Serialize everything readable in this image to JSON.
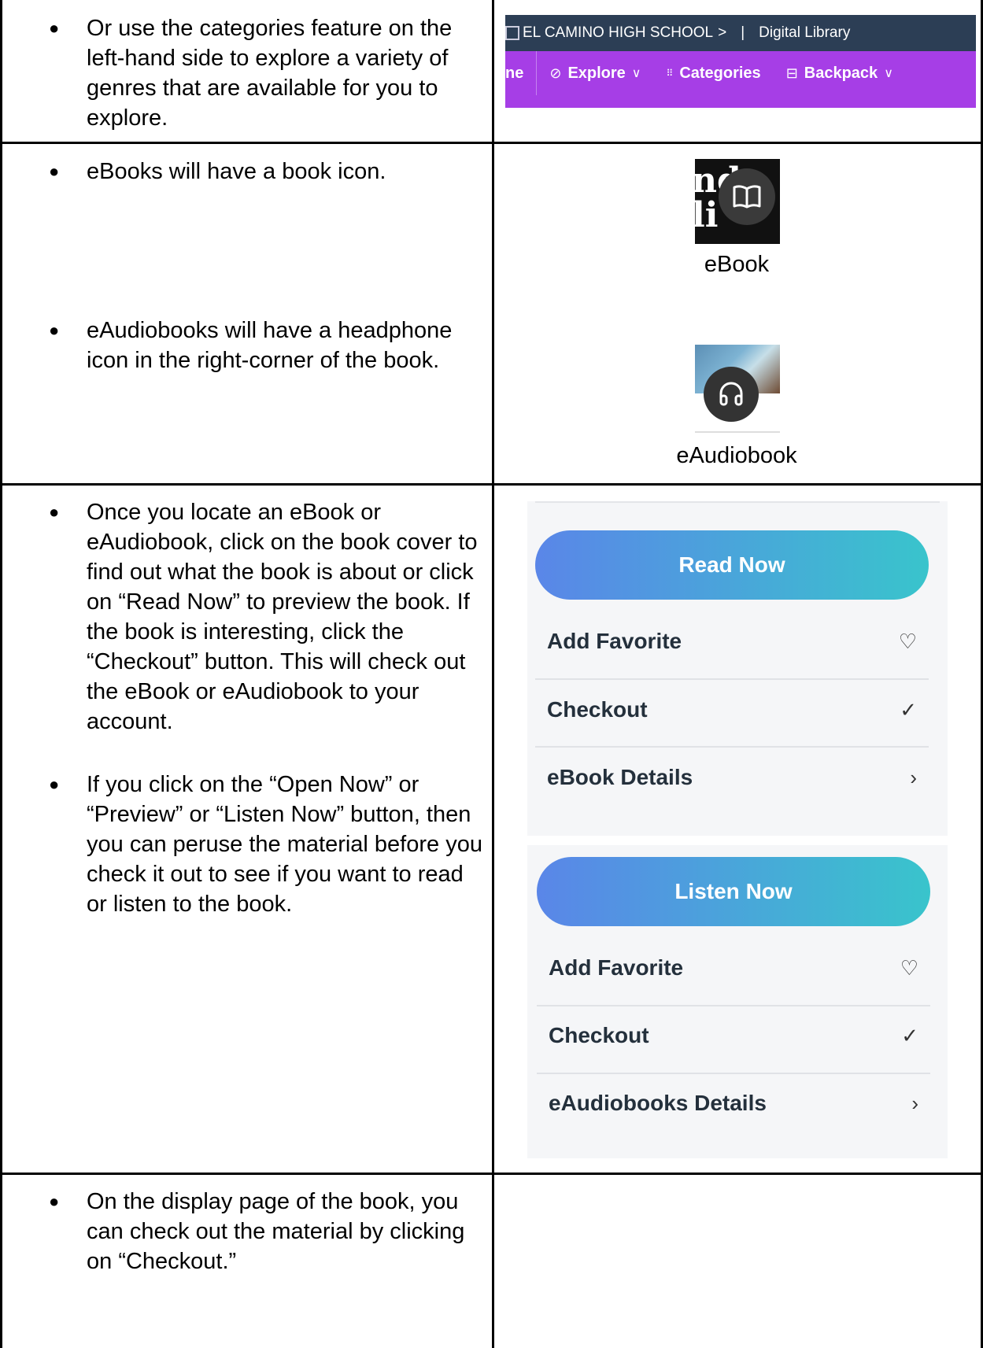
{
  "rows": [
    {
      "bullets": [
        "Or use the categories feature on the left-hand side to explore a variety of genres that are available for you to explore."
      ]
    },
    {
      "bullets": [
        "eBooks will have a book icon.",
        "eAudiobooks will have a headphone  icon in the right-corner of the book."
      ]
    },
    {
      "bullets": [
        "Once you locate an eBook or eAudiobook, click on the book cover to find out what the book is about or click on “Read Now” to preview the book. If the book is interesting, click the “Checkout” button. This will check out the eBook or eAudiobook to your account.",
        "If you click on the “Open Now” or “Preview” or “Listen Now” button, then you can peruse the material before you check it out to see if you want to read or listen to the book."
      ]
    },
    {
      "bullets": [
        "On the display page of the book, you can check out the material by clicking on “Checkout.”"
      ]
    }
  ],
  "nav": {
    "school": "EL CAMINO HIGH SCHOOL",
    "school_chevron": ">",
    "separator": "|",
    "library": "Digital Library",
    "home_fragment": "ne",
    "explore": "Explore",
    "categories": "Categories",
    "backpack": "Backpack",
    "colors": {
      "top_bar": "#2c3e55",
      "bottom_bar": "#a63ee6"
    }
  },
  "icons": {
    "ebook_label": "eBook",
    "eaudiobook_label": "eAudiobook"
  },
  "ebook_panel": {
    "primary_button": "Read Now",
    "options": [
      {
        "label": "Add Favorite",
        "icon": "heart-icon"
      },
      {
        "label": "Checkout",
        "icon": "check-icon"
      },
      {
        "label": "eBook Details",
        "icon": "chevron-right-icon"
      }
    ]
  },
  "audio_panel": {
    "primary_button": "Listen Now",
    "options": [
      {
        "label": "Add Favorite",
        "icon": "heart-icon"
      },
      {
        "label": "Checkout",
        "icon": "check-icon"
      },
      {
        "label": "eAudiobooks Details",
        "icon": "chevron-right-icon"
      }
    ]
  },
  "button_gradient": [
    "#5a86e8",
    "#39c4cc"
  ]
}
